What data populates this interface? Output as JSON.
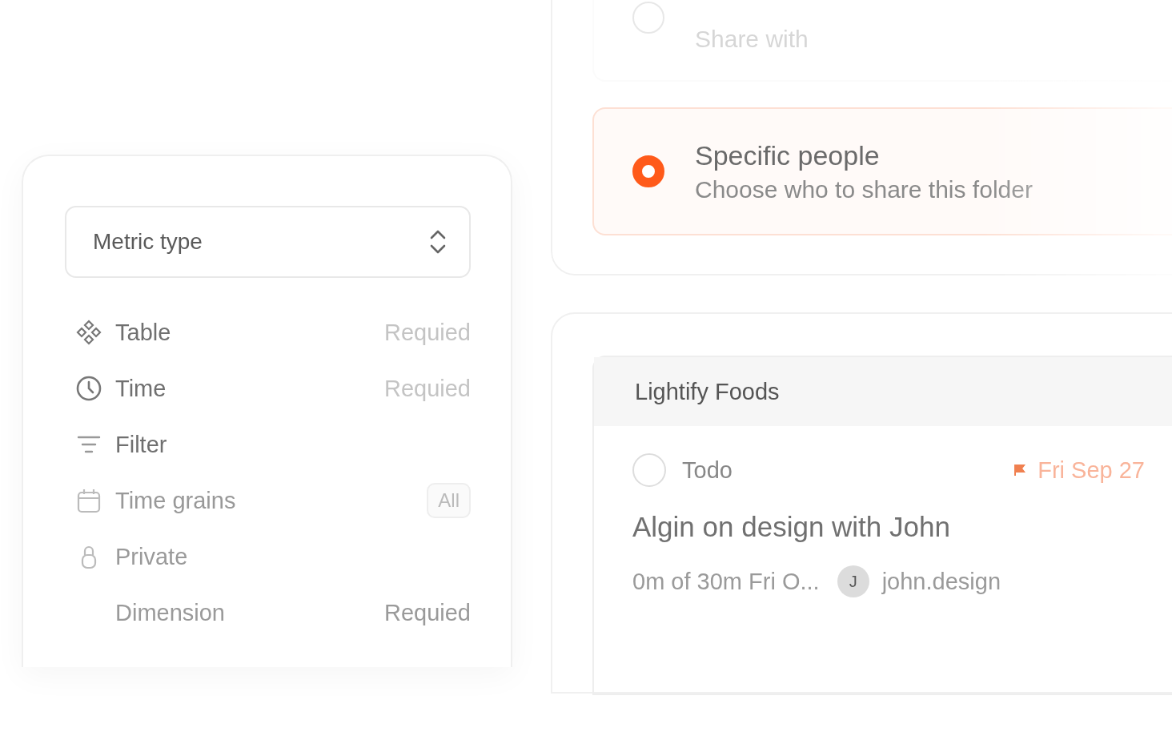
{
  "metric_panel": {
    "select": {
      "value": "Metric type"
    },
    "fields": [
      {
        "kind": "table",
        "label": "Table",
        "hint": "Requied"
      },
      {
        "kind": "clock",
        "label": "Time",
        "hint": "Requied"
      },
      {
        "kind": "filter",
        "label": "Filter"
      },
      {
        "kind": "calendar",
        "label": "Time grains",
        "badge": "All"
      },
      {
        "kind": "lock",
        "label": "Private"
      },
      {
        "kind": "plain",
        "label": "Dimension",
        "hint": "Requied"
      }
    ]
  },
  "share_options": [
    {
      "description": "Share with",
      "selected": false
    },
    {
      "title": "Specific people",
      "description": "Choose who to share this folder",
      "selected": true
    }
  ],
  "task_card": {
    "project": "Lightify Foods",
    "task": {
      "status": "Todo",
      "done": false,
      "due": "Fri Sep 27",
      "title": "Algin on design with John",
      "estimate": "0m of 30m Fri O...",
      "assignee_initial": "J",
      "assignee": "john.design"
    }
  }
}
